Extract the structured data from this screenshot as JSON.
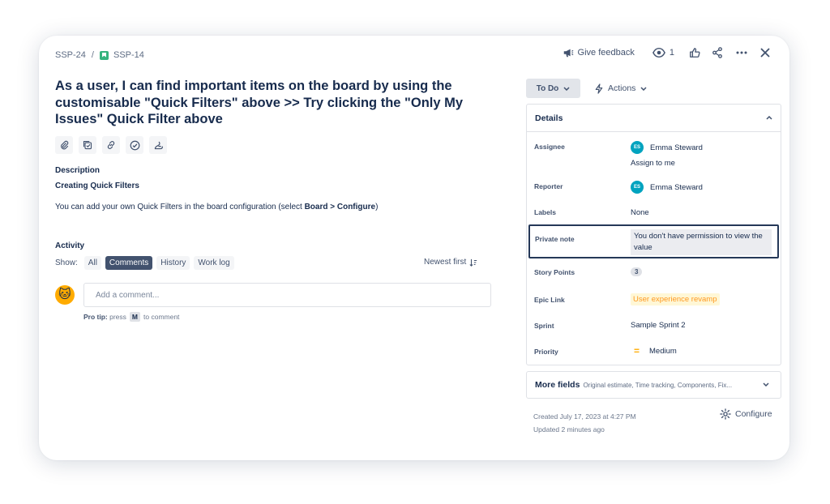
{
  "breadcrumb": {
    "parent": "SSP-24",
    "separator": "/",
    "current": "SSP-14"
  },
  "toolbar": {
    "feedback_label": "Give feedback",
    "watch_count": "1"
  },
  "issue": {
    "title": "As a user, I can find important items on the board by using the customisable \"Quick Filters\" above >> Try clicking the \"Only My Issues\" Quick Filter above"
  },
  "quick_actions": [
    "attach-icon",
    "child-issue-icon",
    "link-icon",
    "check-icon",
    "app-icon"
  ],
  "description": {
    "heading": "Description",
    "subheading": "Creating Quick Filters",
    "body_prefix": "You can add your own Quick Filters in the board configuration (select ",
    "body_bold": "Board > Configure",
    "body_suffix": ")"
  },
  "activity": {
    "heading": "Activity",
    "show_label": "Show:",
    "filters": [
      "All",
      "Comments",
      "History",
      "Work log"
    ],
    "active_filter": "Comments",
    "sort_label": "Newest first",
    "comment_placeholder": "Add a comment...",
    "protip_prefix": "Pro tip:",
    "protip_press": "press",
    "protip_key": "M",
    "protip_suffix": "to comment"
  },
  "status": {
    "label": "To Do",
    "actions_label": "Actions"
  },
  "details": {
    "heading": "Details",
    "assignee_label": "Assignee",
    "assignee_initials": "ES",
    "assignee_name": "Emma Steward",
    "assign_to_me": "Assign to me",
    "reporter_label": "Reporter",
    "reporter_initials": "ES",
    "reporter_name": "Emma Steward",
    "labels_label": "Labels",
    "labels_value": "None",
    "private_label": "Private note",
    "private_value": "You don't have permission to view the value",
    "story_points_label": "Story Points",
    "story_points_value": "3",
    "epic_label": "Epic Link",
    "epic_value": "User experience revamp",
    "sprint_label": "Sprint",
    "sprint_value": "Sample Sprint 2",
    "priority_label": "Priority",
    "priority_symbol": "=",
    "priority_value": "Medium"
  },
  "more_fields": {
    "label": "More fields",
    "summary": "Original estimate, Time tracking, Components, Fix..."
  },
  "meta": {
    "created": "Created July 17, 2023 at 4:27 PM",
    "updated": "Updated 2 minutes ago",
    "configure_label": "Configure"
  },
  "colors": {
    "primary_text": "#172b4d",
    "link": "#0052cc",
    "story": "#36b37e",
    "epic": "#ff991f",
    "priority_medium": "#ffab00",
    "avatar": "#00a3bf"
  }
}
